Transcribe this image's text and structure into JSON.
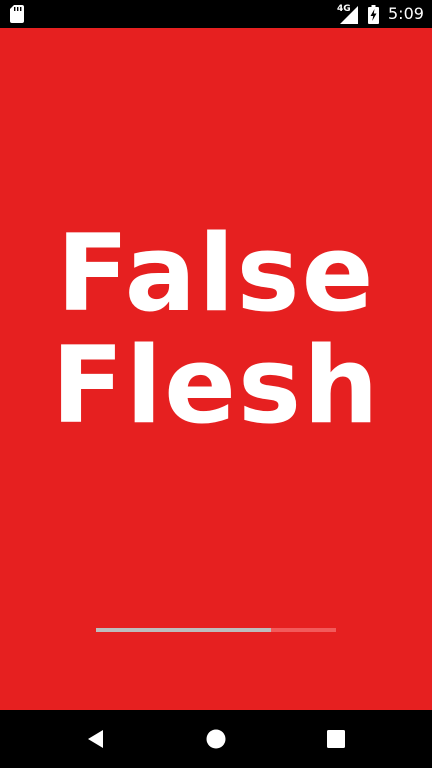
{
  "status_bar": {
    "network": "4G",
    "time": "5:09",
    "icons": [
      "sd-card-icon",
      "signal-icon",
      "battery-charging-icon"
    ]
  },
  "splash": {
    "background": "#e62020",
    "title_line1": "False",
    "title_line2": "Flesh",
    "progress_fraction": 0.73
  },
  "nav_bar": {
    "icons": [
      "back-icon",
      "home-icon",
      "recents-icon"
    ]
  }
}
